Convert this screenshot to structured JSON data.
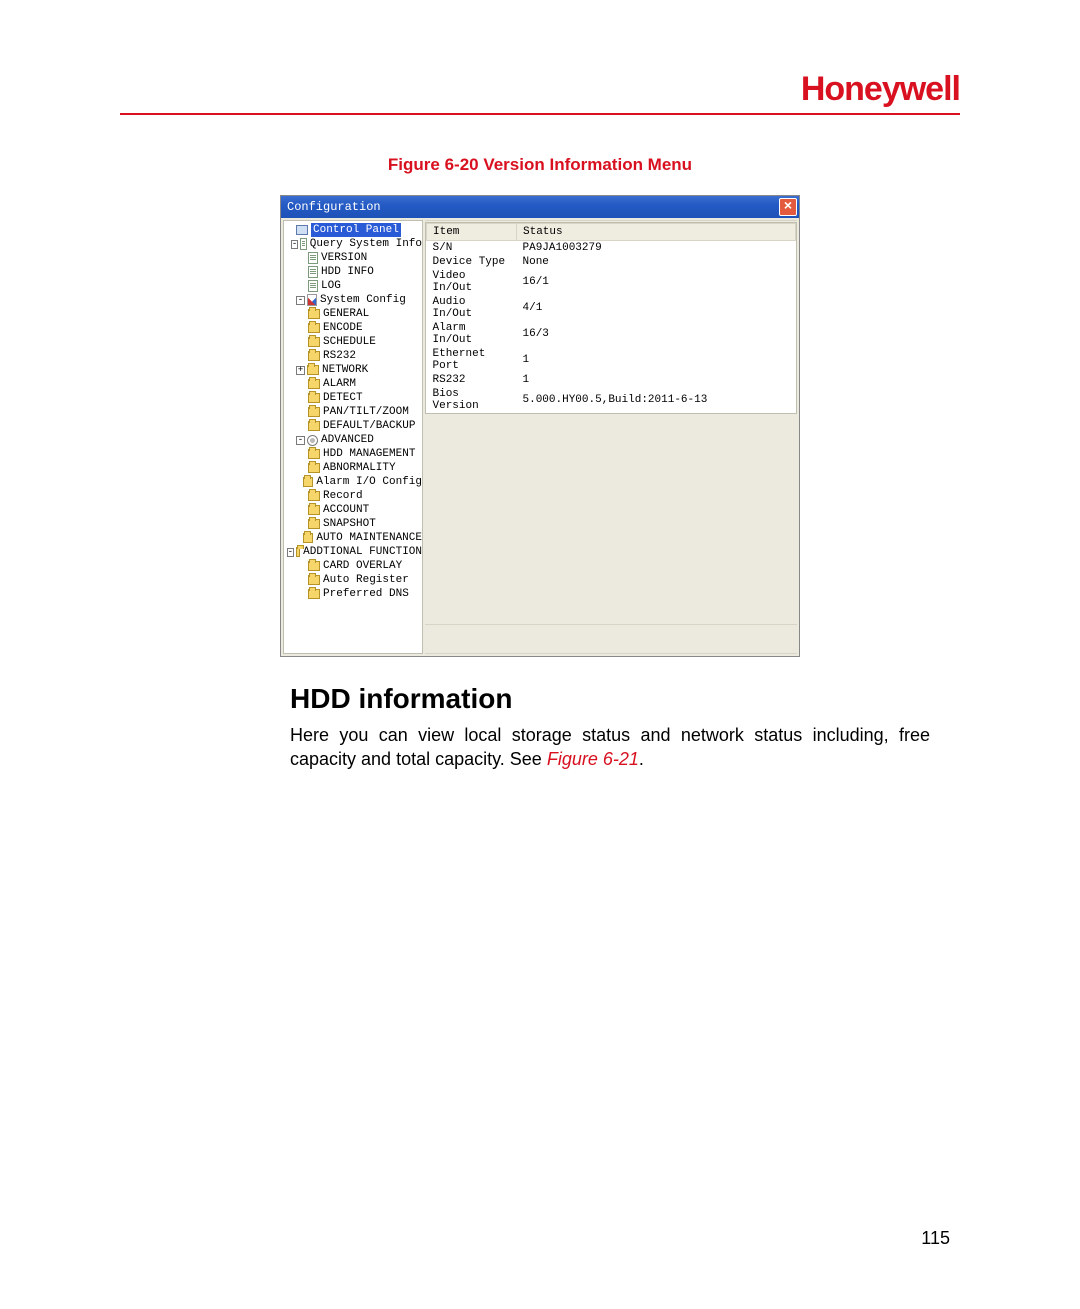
{
  "brand": "Honeywell",
  "caption": "Figure 6-20 Version Information Menu",
  "window": {
    "title": "Configuration",
    "close": "×"
  },
  "tree": {
    "root": "Control Panel",
    "qsi": "Query System Info",
    "version": "VERSION",
    "hddinfo": "HDD INFO",
    "log": "LOG",
    "sysconf": "System Config",
    "general": "GENERAL",
    "encode": "ENCODE",
    "schedule": "SCHEDULE",
    "rs232": "RS232",
    "network": "NETWORK",
    "alarm": "ALARM",
    "detect": "DETECT",
    "ptz": "PAN/TILT/ZOOM",
    "defbk": "DEFAULT/BACKUP",
    "advanced": "ADVANCED",
    "hddmgmt": "HDD MANAGEMENT",
    "abnorm": "ABNORMALITY",
    "aioconf": "Alarm I/O Config",
    "record": "Record",
    "account": "ACCOUNT",
    "snapshot": "SNAPSHOT",
    "automaint": "AUTO MAINTENANCE",
    "addfunc": "ADDTIONAL FUNCTION",
    "cardov": "CARD OVERLAY",
    "autoreg": "Auto Register",
    "prefdns": "Preferred DNS"
  },
  "table": {
    "headers": {
      "item": "Item",
      "status": "Status"
    },
    "rows": [
      {
        "item": "S/N",
        "status": "PA9JA1003279"
      },
      {
        "item": "Device Type",
        "status": "None"
      },
      {
        "item": "Video In/Out",
        "status": "16/1"
      },
      {
        "item": "Audio In/Out",
        "status": "4/1"
      },
      {
        "item": "Alarm In/Out",
        "status": "16/3"
      },
      {
        "item": "Ethernet Port",
        "status": "1"
      },
      {
        "item": "RS232",
        "status": "1"
      },
      {
        "item": "Bios Version",
        "status": "5.000.HY00.5,Build:2011-6-13"
      }
    ]
  },
  "section_title": "HDD information",
  "body_text_1": "Here you can view local storage status and network status including, free capacity and total capacity. See ",
  "fig_ref": "Figure 6-21",
  "body_text_2": ".",
  "page_number": "115"
}
